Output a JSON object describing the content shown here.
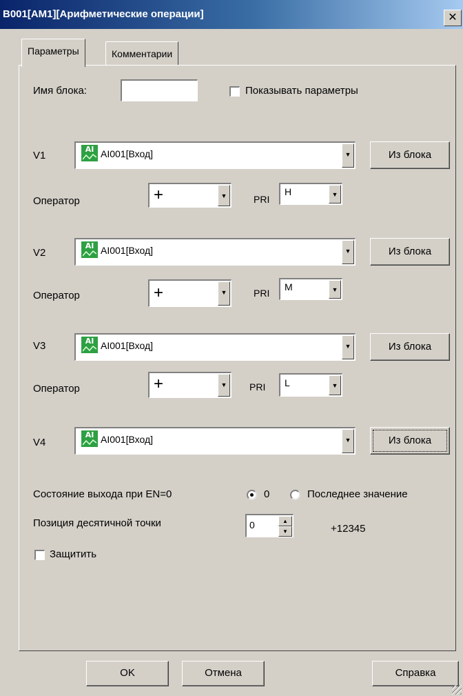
{
  "window": {
    "title": "B001[AM1][Арифметические операции]",
    "close_glyph": "✕"
  },
  "tabs": [
    {
      "label": "Параметры"
    },
    {
      "label": "Комментарии"
    }
  ],
  "block_name": {
    "label": "Имя блока:",
    "value": ""
  },
  "show_params": {
    "label": "Показывать параметры",
    "checked": false
  },
  "values": [
    {
      "label": "V1",
      "source": "AI001[Вход]",
      "icon_text": "AI",
      "button": "Из блока"
    },
    {
      "label": "V2",
      "source": "AI001[Вход]",
      "icon_text": "AI",
      "button": "Из блока"
    },
    {
      "label": "V3",
      "source": "AI001[Вход]",
      "icon_text": "AI",
      "button": "Из блока"
    },
    {
      "label": "V4",
      "source": "AI001[Вход]",
      "icon_text": "AI",
      "button": "Из блока"
    }
  ],
  "operators": [
    {
      "label": "Оператор",
      "value": "+",
      "pri_label": "PRI",
      "pri_value": "H"
    },
    {
      "label": "Оператор",
      "value": "+",
      "pri_label": "PRI",
      "pri_value": "M"
    },
    {
      "label": "Оператор",
      "value": "+",
      "pri_label": "PRI",
      "pri_value": "L"
    }
  ],
  "output_state": {
    "label": "Состояние выхода при EN=0",
    "option_zero": "0",
    "option_last": "Последнее значение",
    "selected": "0"
  },
  "decimal": {
    "label": "Позиция десятичной точки",
    "value": "0",
    "preview": "+12345"
  },
  "protect": {
    "label": "Защитить",
    "checked": false
  },
  "buttons": {
    "ok": "OK",
    "cancel": "Отмена",
    "help": "Справка"
  },
  "colors": {
    "title_start": "#0a246a",
    "title_end": "#a6caf0",
    "dialog_bg": "#d4d0c8",
    "ai_icon": "#2ea043"
  },
  "icons": {
    "combo_arrow": "▼",
    "spin_up": "▲",
    "spin_down": "▼"
  }
}
